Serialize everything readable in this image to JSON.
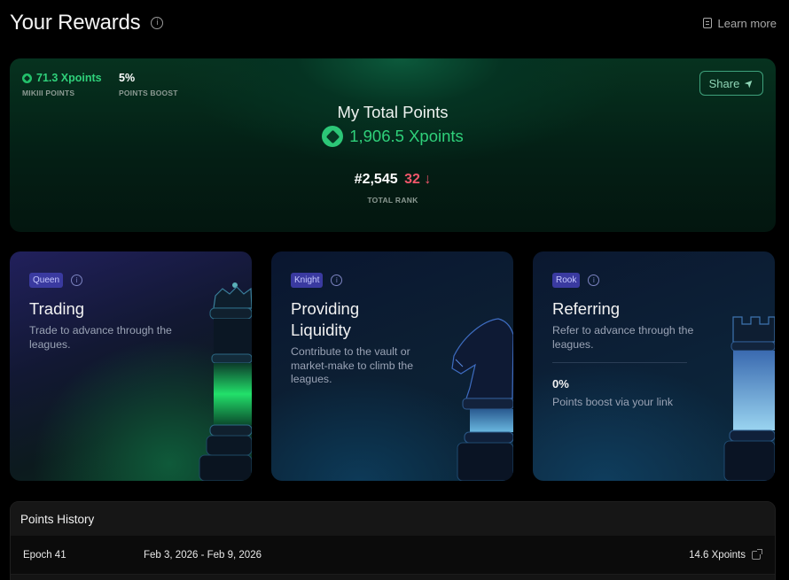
{
  "header": {
    "title": "Your Rewards",
    "learn_more": "Learn more"
  },
  "hero": {
    "stats": [
      {
        "value": "71.3 Xpoints",
        "label": "MIKIII POINTS"
      },
      {
        "value": "5%",
        "label": "POINTS BOOST"
      }
    ],
    "share_label": "Share",
    "total_title": "My Total Points",
    "total_value": "1,906.5 Xpoints",
    "rank": "#2,545",
    "rank_change": "32",
    "rank_arrow": "↓",
    "rank_label": "TOTAL RANK"
  },
  "cards": [
    {
      "tag": "Queen",
      "title": "Trading",
      "description": "Trade to advance through the leagues."
    },
    {
      "tag": "Knight",
      "title": "Providing Liquidity",
      "description": "Contribute to the vault or market-make to climb the leagues."
    },
    {
      "tag": "Rook",
      "title": "Referring",
      "description": "Refer to advance through the leagues.",
      "boost_value": "0%",
      "boost_label": "Points boost via your link"
    }
  ],
  "history": {
    "title": "Points History",
    "rows": [
      {
        "epoch": "Epoch 41",
        "dates": "Feb 3, 2026 - Feb 9, 2026",
        "points": "14.6 Xpoints"
      }
    ]
  },
  "colors": {
    "accent_green": "#2fd07a",
    "rank_down": "#f0566a",
    "tag_bg": "#3a3aa0"
  },
  "icons": [
    "info-icon",
    "document-icon",
    "share-arrow-icon",
    "xpoints-coin-icon",
    "arrow-down-icon",
    "external-link-icon",
    "queen-piece-icon",
    "knight-piece-icon",
    "rook-piece-icon"
  ]
}
